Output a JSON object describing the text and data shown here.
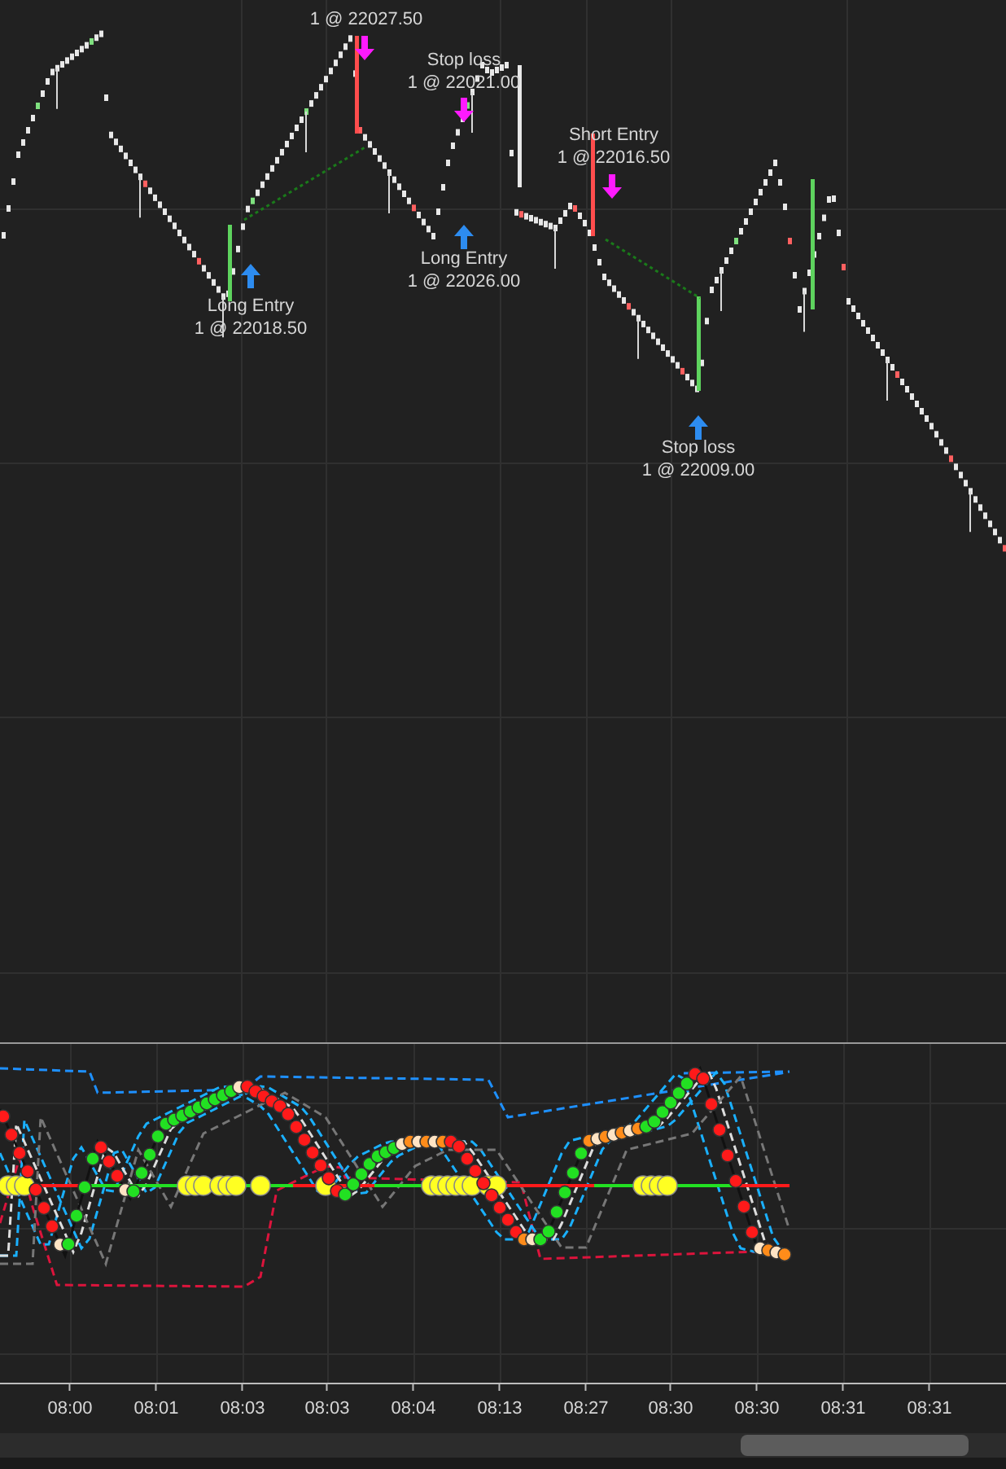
{
  "price_chart": {
    "annotations": [
      {
        "lines": [
          "1 @ 22027.50"
        ]
      },
      {
        "lines": [
          "Stop loss",
          "1 @ 22021.00"
        ]
      },
      {
        "lines": [
          "Short Entry",
          "1 @ 22016.50"
        ]
      },
      {
        "lines": [
          "Long Entry",
          "1 @ 22026.00"
        ]
      },
      {
        "lines": [
          "Long Entry",
          "1 @ 22018.50"
        ]
      },
      {
        "lines": [
          "Stop loss",
          "1 @ 22009.00"
        ]
      }
    ]
  },
  "time_axis": {
    "labels": [
      "08:00",
      "08:01",
      "08:03",
      "08:03",
      "08:04",
      "08:13",
      "08:27",
      "08:30",
      "08:30",
      "08:31",
      "08:31"
    ]
  }
}
